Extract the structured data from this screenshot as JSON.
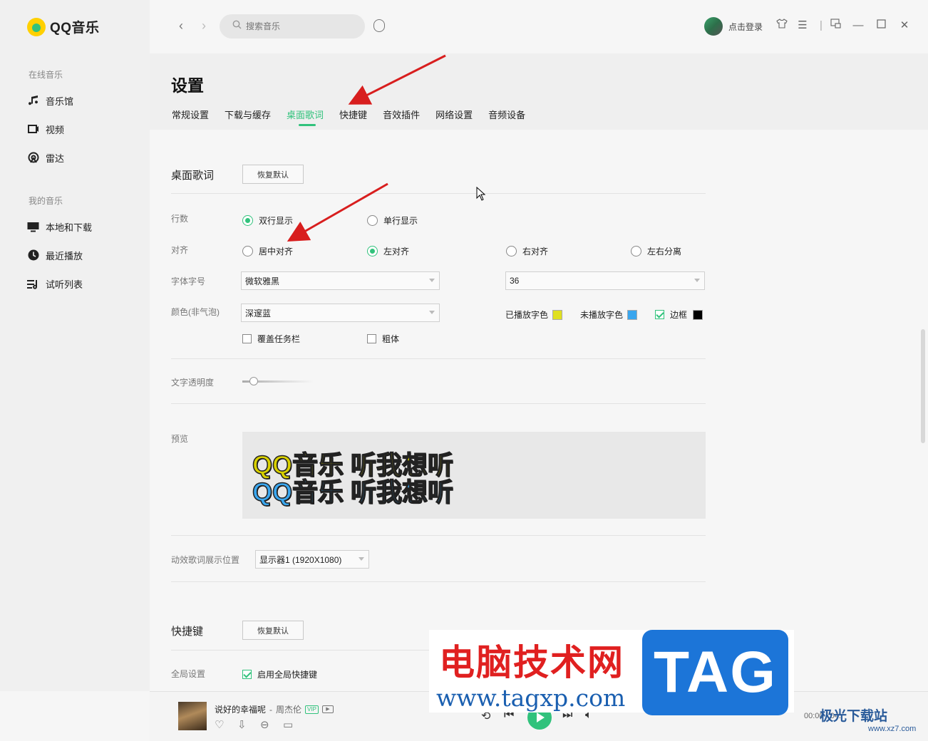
{
  "app": {
    "name": "QQ音乐"
  },
  "sidebar": {
    "groups": [
      {
        "label": "在线音乐",
        "items": [
          {
            "label": "音乐馆",
            "icon": "music-note-icon"
          },
          {
            "label": "视频",
            "icon": "video-icon"
          },
          {
            "label": "雷达",
            "icon": "radar-icon"
          }
        ]
      },
      {
        "label": "我的音乐",
        "items": [
          {
            "label": "本地和下载",
            "icon": "monitor-icon"
          },
          {
            "label": "最近播放",
            "icon": "clock-icon"
          },
          {
            "label": "试听列表",
            "icon": "playlist-icon"
          }
        ]
      }
    ]
  },
  "topbar": {
    "search_placeholder": "搜索音乐",
    "login_label": "点击登录"
  },
  "settings": {
    "title": "设置",
    "tabs": [
      {
        "label": "常规设置",
        "active": false
      },
      {
        "label": "下载与缓存",
        "active": false
      },
      {
        "label": "桌面歌词",
        "active": true
      },
      {
        "label": "快捷键",
        "active": false
      },
      {
        "label": "音效插件",
        "active": false
      },
      {
        "label": "网络设置",
        "active": false
      },
      {
        "label": "音频设备",
        "active": false
      }
    ]
  },
  "lyrics": {
    "section_title": "桌面歌词",
    "reset_label": "恢复默认",
    "lines_label": "行数",
    "lines_options": [
      {
        "label": "双行显示",
        "checked": true
      },
      {
        "label": "单行显示",
        "checked": false
      }
    ],
    "align_label": "对齐",
    "align_options": [
      {
        "label": "居中对齐",
        "checked": false
      },
      {
        "label": "左对齐",
        "checked": true
      },
      {
        "label": "右对齐",
        "checked": false
      },
      {
        "label": "左右分离",
        "checked": false
      }
    ],
    "font_label": "字体字号",
    "font_value": "微软雅黑",
    "size_value": "36",
    "color_label": "颜色(非气泡)",
    "color_value": "深邃蓝",
    "played_color_label": "已播放字色",
    "played_color": "#e0e020",
    "unplayed_color_label": "未播放字色",
    "unplayed_color": "#3aa6ee",
    "border_label": "边框",
    "border_checked": true,
    "border_color": "#000000",
    "cover_taskbar_label": "覆盖任务栏",
    "cover_taskbar_checked": false,
    "bold_label": "粗体",
    "bold_checked": false,
    "opacity_label": "文字透明度",
    "opacity_level": 0.1,
    "preview_label": "预览",
    "preview_line1": "QQ音乐 听我想听",
    "preview_line2": "QQ音乐 听我想听",
    "position_label": "动效歌词展示位置",
    "position_value": "显示器1 (1920X1080)"
  },
  "hotkeys": {
    "section_title": "快捷键",
    "reset_label": "恢复默认",
    "global_label": "全局设置",
    "enable_global_label": "启用全局快捷键",
    "enable_global_checked": true
  },
  "player": {
    "song_title": "说好的幸福呢",
    "separator": "-",
    "artist": "周杰伦",
    "vip_badge": "VIP",
    "time": "00:00 / 04:"
  },
  "watermark": {
    "title": "电脑技术网",
    "url": "www.tagxp.com",
    "tag": "TAG",
    "site_name": "极光下载站",
    "site_url": "www.xz7.com"
  }
}
